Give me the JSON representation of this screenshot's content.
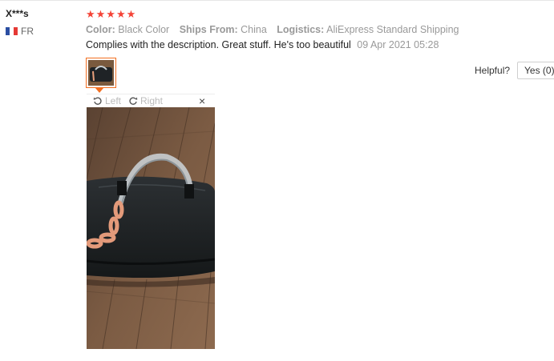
{
  "review": {
    "user_name": "X***s",
    "country_code": "FR",
    "rating_stars": "★★★★★",
    "attributes": [
      {
        "key": "Color:",
        "value": "Black Color"
      },
      {
        "key": "Ships From:",
        "value": "China"
      },
      {
        "key": "Logistics:",
        "value": "AliExpress Standard Shipping"
      }
    ],
    "comment": "Complies with the description. Great stuff. He's too beautiful",
    "date": "09 Apr 2021 05:28",
    "helpful_label": "Helpful?",
    "yes_label": "Yes (0)"
  },
  "viewer": {
    "rotate_left_label": "Left",
    "rotate_right_label": "Right",
    "close_symbol": "×"
  },
  "colors": {
    "star": "#f44336",
    "thumb_border": "#f26f21",
    "muted_text": "#999999"
  },
  "icons": {
    "flag": "france-flag-icon",
    "rotate_left": "rotate-left-icon",
    "rotate_right": "rotate-right-icon",
    "close": "close-icon"
  }
}
